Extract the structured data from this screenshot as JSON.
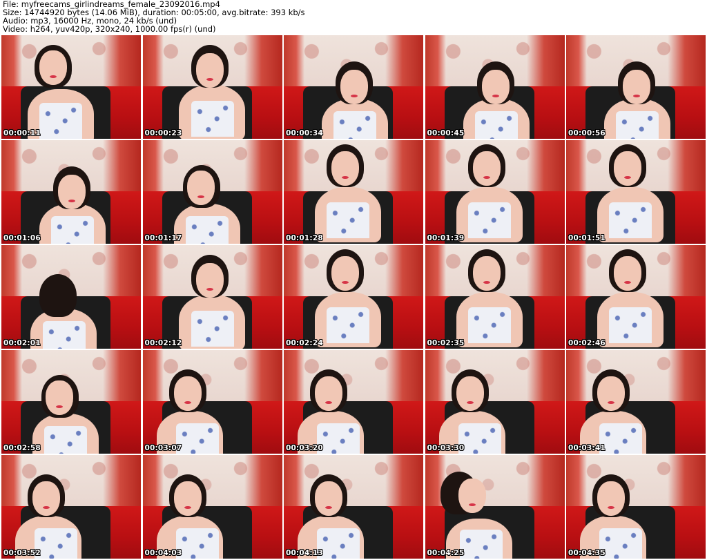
{
  "header": {
    "file_line": "File: myfreecams_girlindreams_female_23092016.mp4",
    "size_line": "Size: 14744920 bytes (14.06 MiB), duration: 00:05:00, avg.bitrate: 393 kb/s",
    "audio_line": "Audio: mp3, 16000 Hz, mono, 24 kb/s (und)",
    "video_line": "Video: h264, yuv420p, 320x240, 1000.00 fps(r) (und)"
  },
  "thumbnails": [
    {
      "time": "00:00:11",
      "pose": "phone"
    },
    {
      "time": "00:00:23",
      "pose": "down"
    },
    {
      "time": "00:00:34",
      "pose": "lean"
    },
    {
      "time": "00:00:45",
      "pose": "lean"
    },
    {
      "time": "00:00:56",
      "pose": "lean"
    },
    {
      "time": "00:01:06",
      "pose": "lean"
    },
    {
      "time": "00:01:17",
      "pose": "side"
    },
    {
      "time": "00:01:28",
      "pose": "sit"
    },
    {
      "time": "00:01:39",
      "pose": "sit"
    },
    {
      "time": "00:01:51",
      "pose": "sit"
    },
    {
      "time": "00:02:01",
      "pose": "back"
    },
    {
      "time": "00:02:12",
      "pose": "down"
    },
    {
      "time": "00:02:24",
      "pose": "sit"
    },
    {
      "time": "00:02:35",
      "pose": "sit"
    },
    {
      "time": "00:02:46",
      "pose": "sit"
    },
    {
      "time": "00:02:58",
      "pose": "side"
    },
    {
      "time": "00:03:07",
      "pose": "hand"
    },
    {
      "time": "00:03:20",
      "pose": "hand"
    },
    {
      "time": "00:03:30",
      "pose": "hand"
    },
    {
      "time": "00:03:41",
      "pose": "hand"
    },
    {
      "time": "00:03:52",
      "pose": "hand"
    },
    {
      "time": "00:04:03",
      "pose": "hand"
    },
    {
      "time": "00:04:13",
      "pose": "hand"
    },
    {
      "time": "00:04:25",
      "pose": "profile"
    },
    {
      "time": "00:04:35",
      "pose": "hand"
    }
  ]
}
